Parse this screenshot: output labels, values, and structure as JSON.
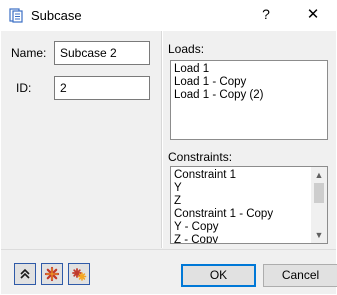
{
  "window": {
    "title": "Subcase",
    "help_glyph": "?",
    "close_glyph": "✕",
    "icon": "clipboard-icon"
  },
  "form": {
    "name_label": "Name:",
    "name_value": "Subcase 2",
    "id_label": "ID:",
    "id_value": "2"
  },
  "loads": {
    "label": "Loads:",
    "items": [
      "Load 1",
      "Load 1 - Copy",
      "Load 1 - Copy (2)"
    ]
  },
  "constraints": {
    "label": "Constraints:",
    "items": [
      "Constraint 1",
      "Y",
      "Z",
      "Constraint 1 - Copy",
      "Y - Copy",
      "Z - Copy"
    ]
  },
  "toolbar": {
    "icons": [
      "move-up-icon",
      "asterisk-icon",
      "multi-asterisk-icon"
    ]
  },
  "buttons": {
    "ok": "OK",
    "cancel": "Cancel"
  },
  "colors": {
    "focus_border": "#0078d7",
    "tool_border": "#2f5aa8",
    "asterisk_fill": "#f5a623",
    "asterisk_stroke": "#c0392b"
  }
}
